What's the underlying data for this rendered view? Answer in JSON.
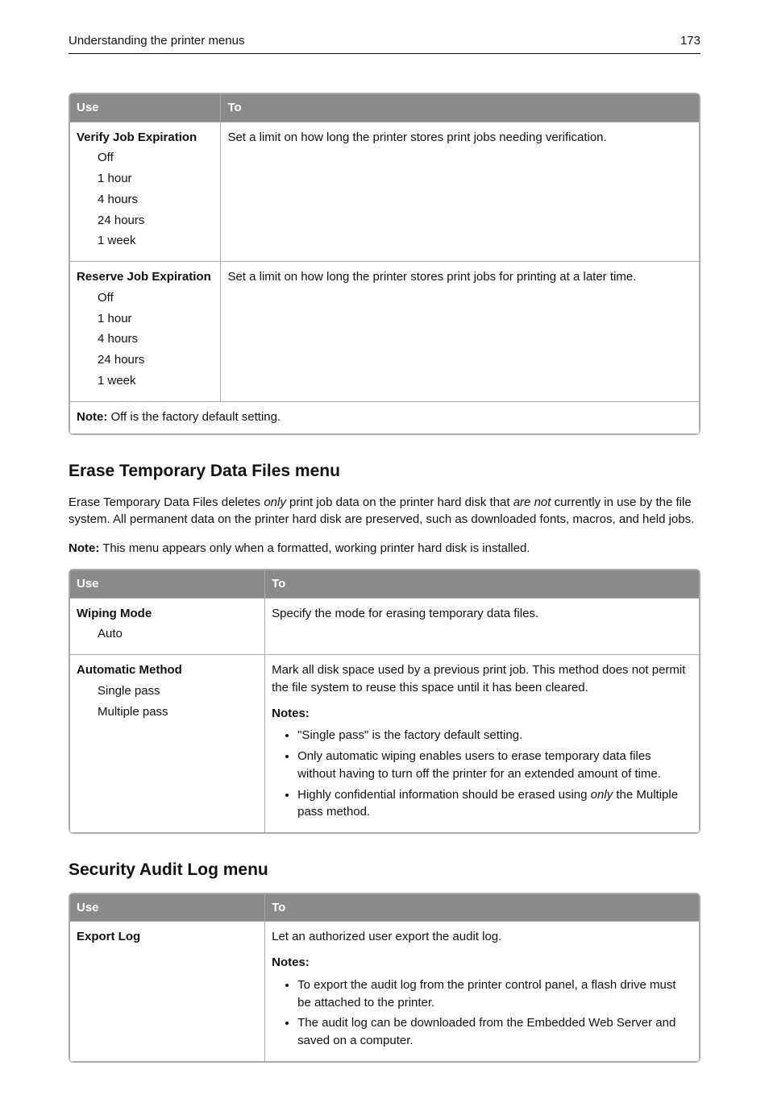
{
  "header": {
    "title": "Understanding the printer menus",
    "page": "173"
  },
  "table1": {
    "h1": "Use",
    "h2": "To",
    "rows": [
      {
        "title": "Verify Job Expiration",
        "opts": [
          "Off",
          "1 hour",
          "4 hours",
          "24 hours",
          "1 week"
        ],
        "desc": "Set a limit on how long the printer stores print jobs needing verification."
      },
      {
        "title": "Reserve Job Expiration",
        "opts": [
          "Off",
          "1 hour",
          "4 hours",
          "24 hours",
          "1 week"
        ],
        "desc": "Set a limit on how long the printer stores print jobs for printing at a later time."
      }
    ],
    "note_b": "Note:",
    "note_t": " Off is the factory default setting."
  },
  "sec2": {
    "heading": "Erase Temporary Data Files menu",
    "p1a": "Erase Temporary Data Files deletes ",
    "p1b": "only",
    "p1c": " print job data on the printer hard disk that ",
    "p1d": "are not",
    "p1e": " currently in use by the file system. All permanent data on the printer hard disk are preserved, such as downloaded fonts, macros, and held jobs.",
    "p2b": "Note:",
    "p2t": " This menu appears only when a formatted, working printer hard disk is installed."
  },
  "table2": {
    "h1": "Use",
    "h2": "To",
    "r1_title": "Wiping Mode",
    "r1_opts": [
      "Auto"
    ],
    "r1_desc": "Specify the mode for erasing temporary data files.",
    "r2_title": "Automatic Method",
    "r2_opts": [
      "Single pass",
      "Multiple pass"
    ],
    "r2_p1": "Mark all disk space used by a previous print job. This method does not permit the file system to reuse this space until it has been cleared.",
    "r2_notes_b": "Notes:",
    "r2_li1": "\"Single pass\" is the factory default setting.",
    "r2_li2": "Only automatic wiping enables users to erase temporary data files without having to turn off the printer for an extended amount of time.",
    "r2_li3a": "Highly confidential information should be erased using ",
    "r2_li3b": "only",
    "r2_li3c": " the Multiple pass method."
  },
  "sec3": {
    "heading": "Security Audit Log menu"
  },
  "table3": {
    "h1": "Use",
    "h2": "To",
    "r1_title": "Export Log",
    "r1_p1": "Let an authorized user export the audit log.",
    "r1_notes_b": "Notes:",
    "r1_li1": "To export the audit log from the printer control panel, a flash drive must be attached to the printer.",
    "r1_li2": "The audit log can be downloaded from the Embedded Web Server and saved on a computer."
  }
}
